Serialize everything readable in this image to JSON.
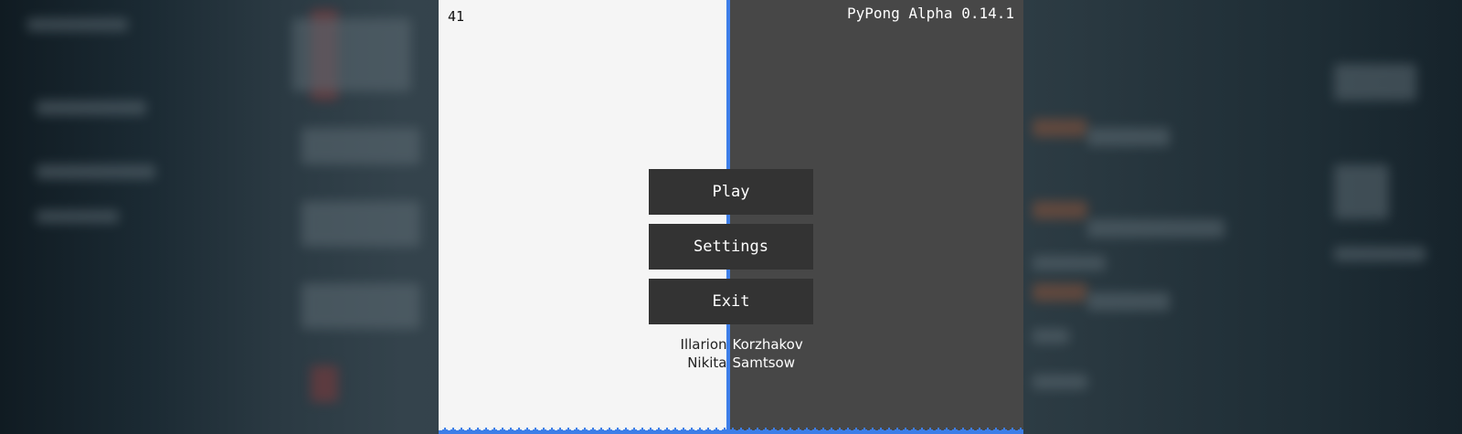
{
  "game": {
    "fps": "41",
    "version": "PyPong Alpha 0.14.1"
  },
  "menu": {
    "play_label": "Play",
    "settings_label": "Settings",
    "exit_label": "Exit"
  },
  "credits": [
    {
      "first": "Illarion",
      "last": "Korzhakov"
    },
    {
      "first": "Nikita",
      "last": "Samtsow"
    }
  ],
  "colors": {
    "left_field": "#f5f5f5",
    "right_field": "#474747",
    "center_line": "#3d7ee8",
    "button_bg": "#333333",
    "spikes": "#3d7ee8"
  }
}
